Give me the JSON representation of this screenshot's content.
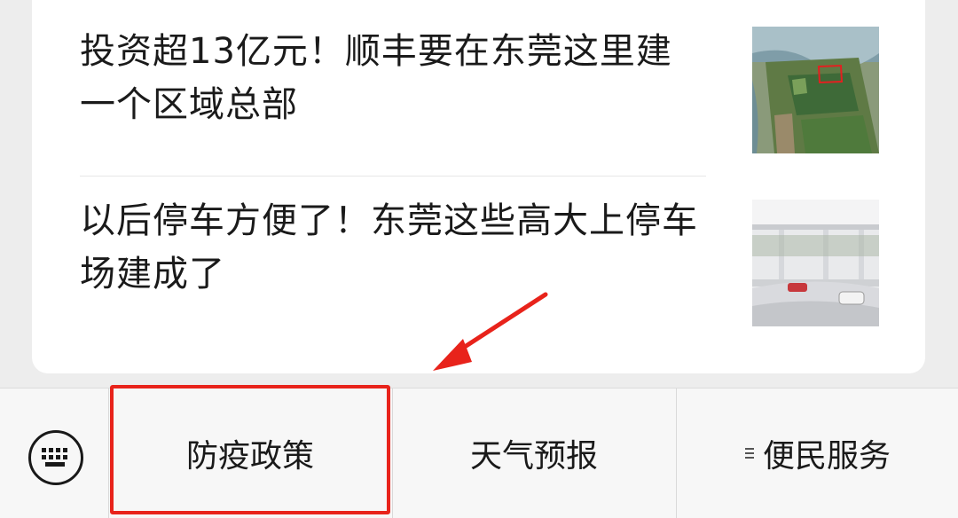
{
  "articles": [
    {
      "title": "投资超13亿元！顺丰要在东莞这里建一个区域总部",
      "thumb_icon": "aerial-land-photo"
    },
    {
      "title": "以后停车方便了！东莞这些高大上停车场建成了",
      "thumb_icon": "parking-garage-photo"
    }
  ],
  "menu": {
    "keyboard_icon": "keyboard-icon",
    "items": [
      {
        "label": "防疫政策"
      },
      {
        "label": "天气预报"
      },
      {
        "label": "便民服务",
        "prefix_icon": "list-icon"
      }
    ]
  },
  "annotation": {
    "color": "#e8231b"
  }
}
